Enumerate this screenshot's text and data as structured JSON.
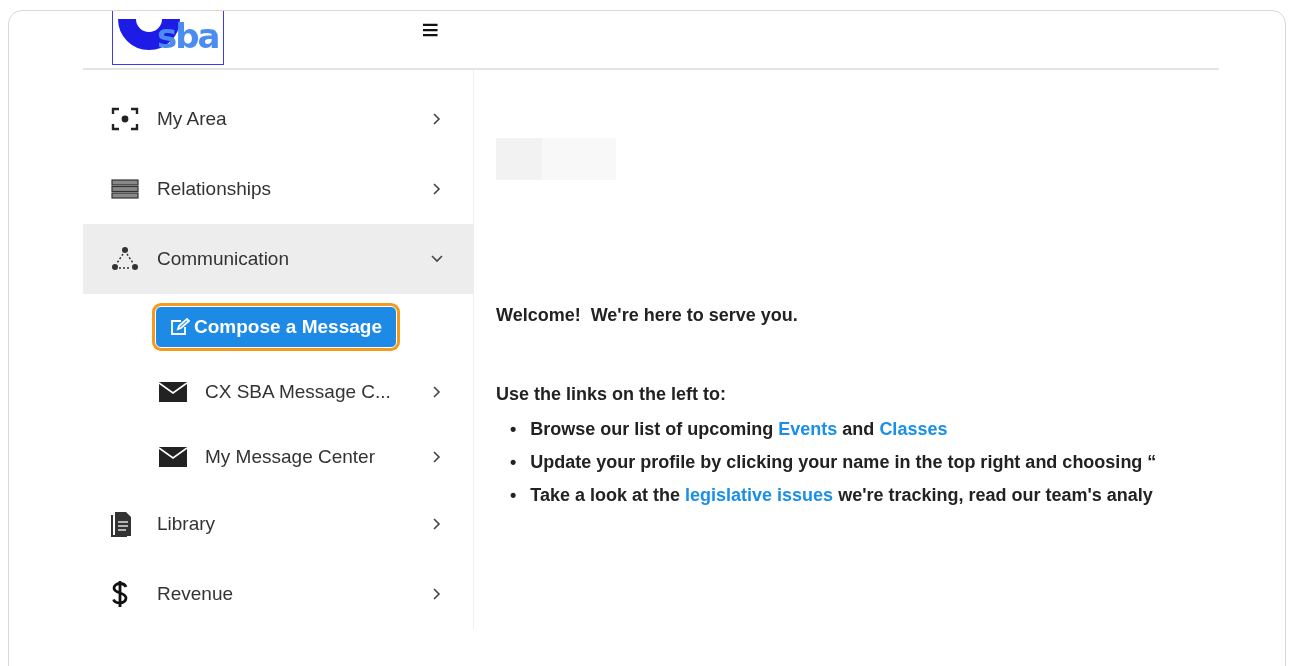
{
  "header": {
    "logo_text": "sba",
    "menu_icon": "≡"
  },
  "sidebar": {
    "items": [
      {
        "kind": "item",
        "label": "My Area",
        "expanded": false,
        "selected": false
      },
      {
        "kind": "item",
        "label": "Relationships",
        "expanded": false,
        "selected": false
      },
      {
        "kind": "item",
        "label": "Communication",
        "expanded": true,
        "selected": true,
        "children": [
          {
            "kind": "button",
            "label": "Compose a Message",
            "highlighted": true
          },
          {
            "kind": "item",
            "label": "CX SBA Message C...",
            "expanded": false,
            "selected": false
          },
          {
            "kind": "item",
            "label": "My Message Center",
            "expanded": false,
            "selected": false
          }
        ]
      },
      {
        "kind": "item",
        "label": "Library",
        "expanded": false,
        "selected": false
      },
      {
        "kind": "item",
        "label": "Revenue",
        "expanded": false,
        "selected": false
      }
    ]
  },
  "main": {
    "welcome": "Welcome!  We're here to serve you.",
    "intro": "Use the links on the left to:",
    "bullets": [
      {
        "marker": "•",
        "parts": [
          {
            "kind": "text",
            "text": "Browse our list of upcoming "
          },
          {
            "kind": "link",
            "text": "Events"
          },
          {
            "kind": "text",
            "text": " and "
          },
          {
            "kind": "link",
            "text": "Classes"
          }
        ]
      },
      {
        "marker": "•",
        "parts": [
          {
            "kind": "text",
            "text": "Update your profile by clicking your name in the top right and choosing “"
          }
        ]
      },
      {
        "marker": "•",
        "parts": [
          {
            "kind": "text",
            "text": "Take a look at the "
          },
          {
            "kind": "link",
            "text": "legislative issues"
          },
          {
            "kind": "text",
            "text": " we're tracking, read our team's analy"
          }
        ]
      }
    ]
  }
}
